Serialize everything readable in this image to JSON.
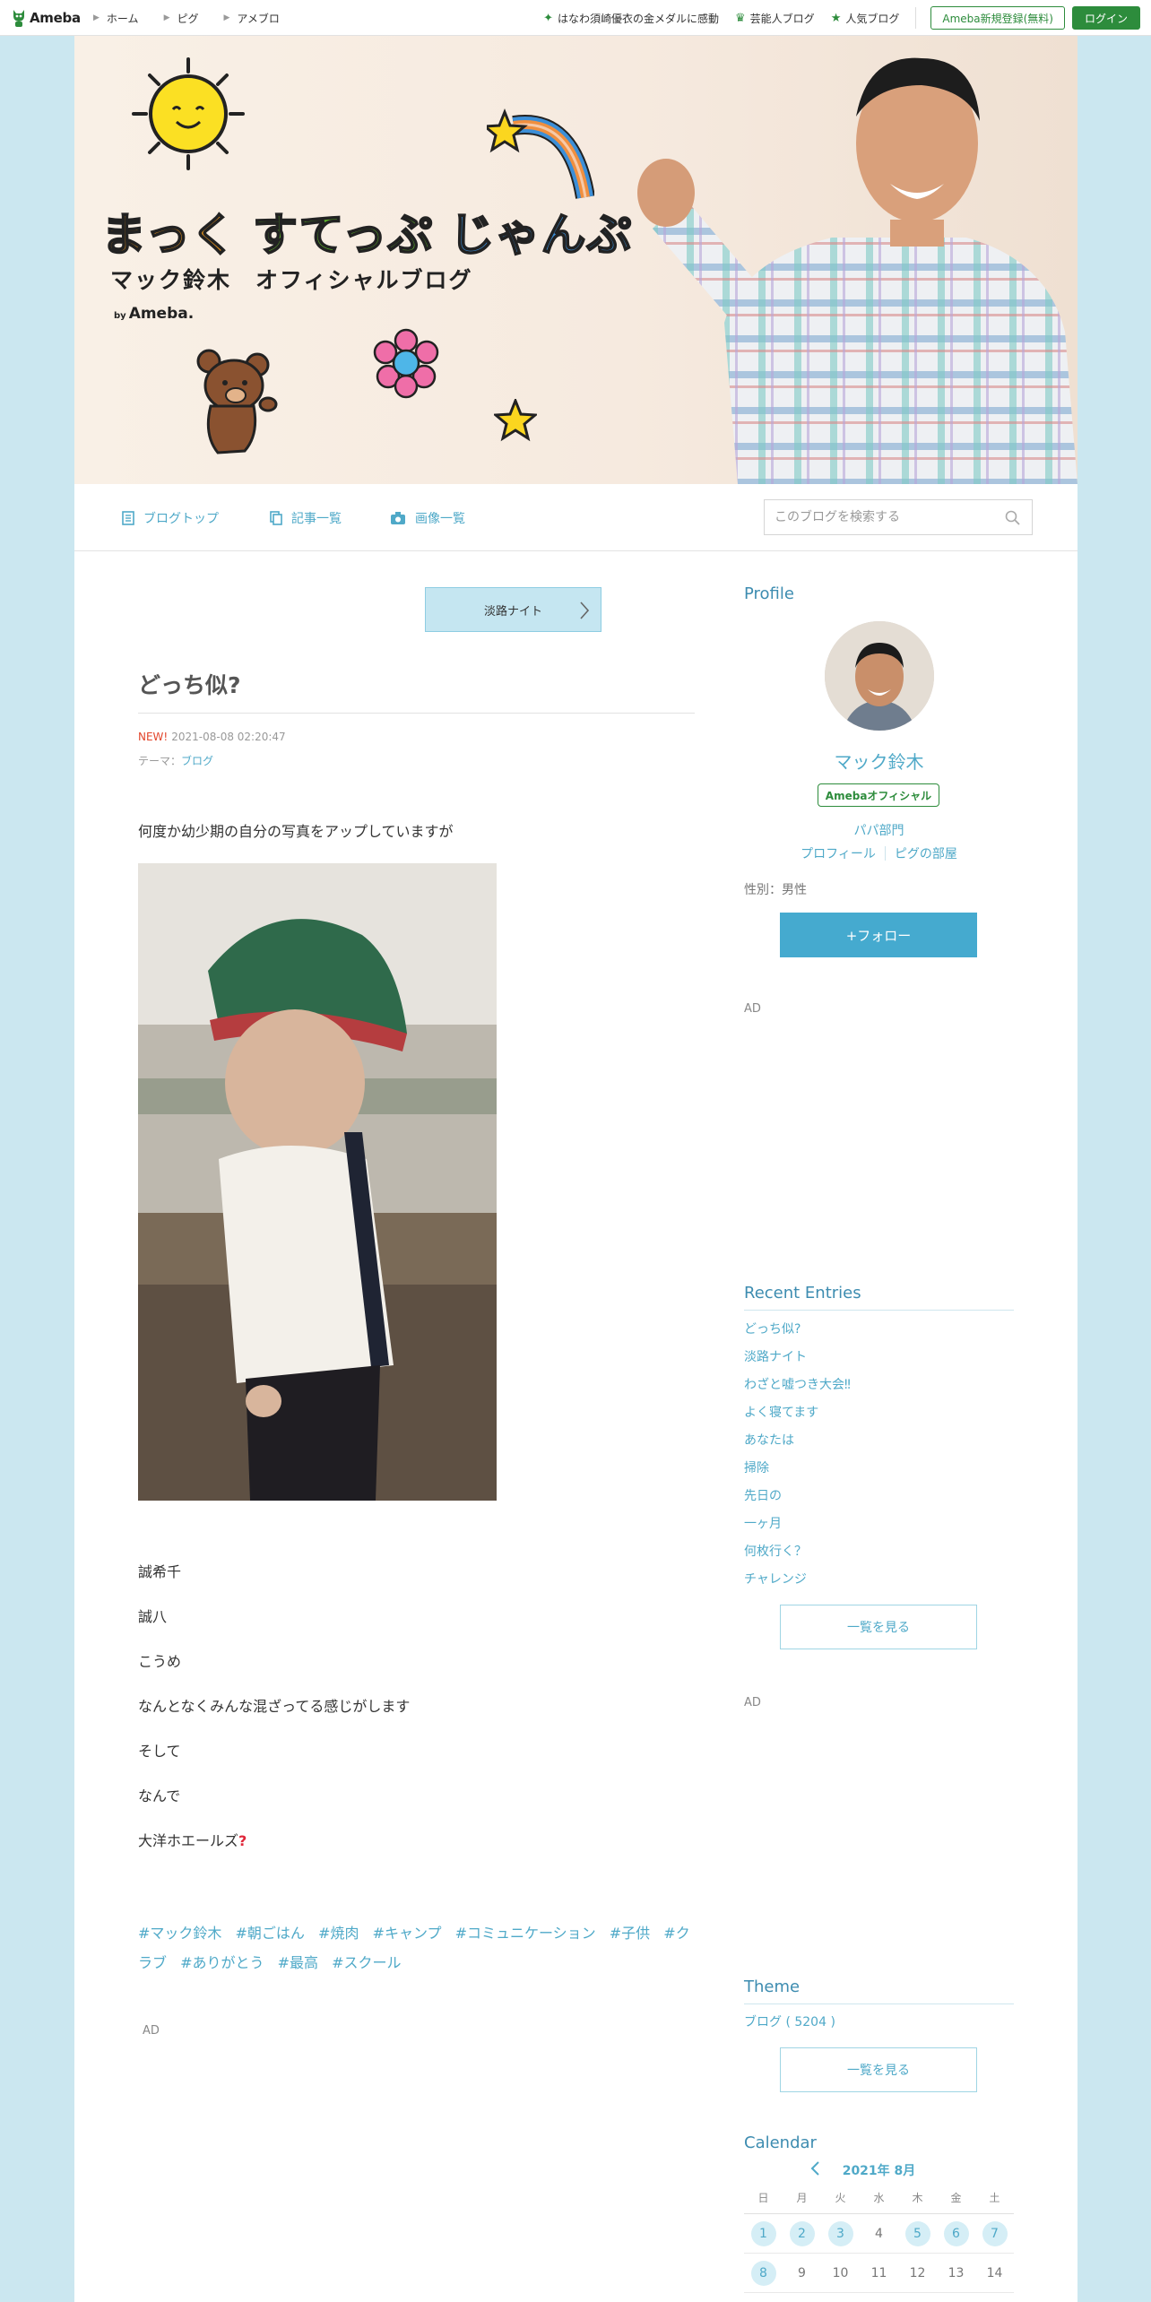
{
  "topbar": {
    "logo": "Ameba",
    "nav": [
      "ホーム",
      "ピグ",
      "アメブロ"
    ],
    "links": [
      "はなわ須崎優衣の金メダルに感動",
      "芸能人ブログ",
      "人気ブログ"
    ],
    "register": "Ameba新規登録(無料)",
    "login": "ログイン"
  },
  "header": {
    "title_part1": "まっく",
    "title_part2": "すてっぷ",
    "title_part3": "じゃんぷ",
    "subtitle": "マック鈴木　オフィシャルブログ",
    "by": "by",
    "brand": "Ameba."
  },
  "blognav": {
    "items": [
      "ブログトップ",
      "記事一覧",
      "画像一覧"
    ],
    "search_placeholder": "このブログを検索する"
  },
  "entry": {
    "prev_label": "淡路ナイト",
    "title": "どっち似?",
    "new_label": "NEW!",
    "date": "2021-08-08 02:20:47",
    "theme_prefix": "テーマ：",
    "theme": "ブログ",
    "paragraphs": [
      "何度か幼少期の自分の写真をアップしていますが",
      "誠希千",
      "誠八",
      "こうめ",
      "なんとなくみんな混ざってる感じがします",
      "そして",
      "なんで",
      "大洋ホエールズ"
    ],
    "hashtags": [
      "#マック鈴木",
      "#朝ごはん",
      "#焼肉",
      "#キャンプ",
      "#コミュニケーション",
      "#子供",
      "#クラブ",
      "#ありがとう",
      "#最高",
      "#スクール"
    ],
    "ad": "AD"
  },
  "sidebar": {
    "profile_heading": "Profile",
    "name": "マック鈴木",
    "badge": "Amebaオフィシャル",
    "category": "パパ部門",
    "link_profile": "プロフィール",
    "link_pig": "ピグの部屋",
    "gender": "性別：男性",
    "follow": "+フォロー",
    "ad": "AD",
    "recent_heading": "Recent Entries",
    "recent": [
      "どっち似?",
      "淡路ナイト",
      "わざと嘘つき大会‼",
      "よく寝てます",
      "あなたは",
      "掃除",
      "先日の",
      "一ヶ月",
      "何枚行く？",
      "チャレンジ"
    ],
    "see_all": "一覧を見る",
    "theme_heading": "Theme",
    "theme_item": "ブログ ( 5204 )",
    "calendar_heading": "Calendar",
    "calendar_month": "2021年 8月",
    "weekdays": [
      "日",
      "月",
      "火",
      "水",
      "木",
      "金",
      "土"
    ],
    "week1": [
      "1",
      "2",
      "3",
      "4",
      "5",
      "6",
      "7"
    ],
    "week2": [
      "8",
      "9",
      "10",
      "11",
      "12",
      "13",
      "14"
    ]
  },
  "colors": {
    "accent": "#4fa9c8",
    "ameba_green": "#2d8c3c",
    "page_bg": "#cbe7f0"
  }
}
